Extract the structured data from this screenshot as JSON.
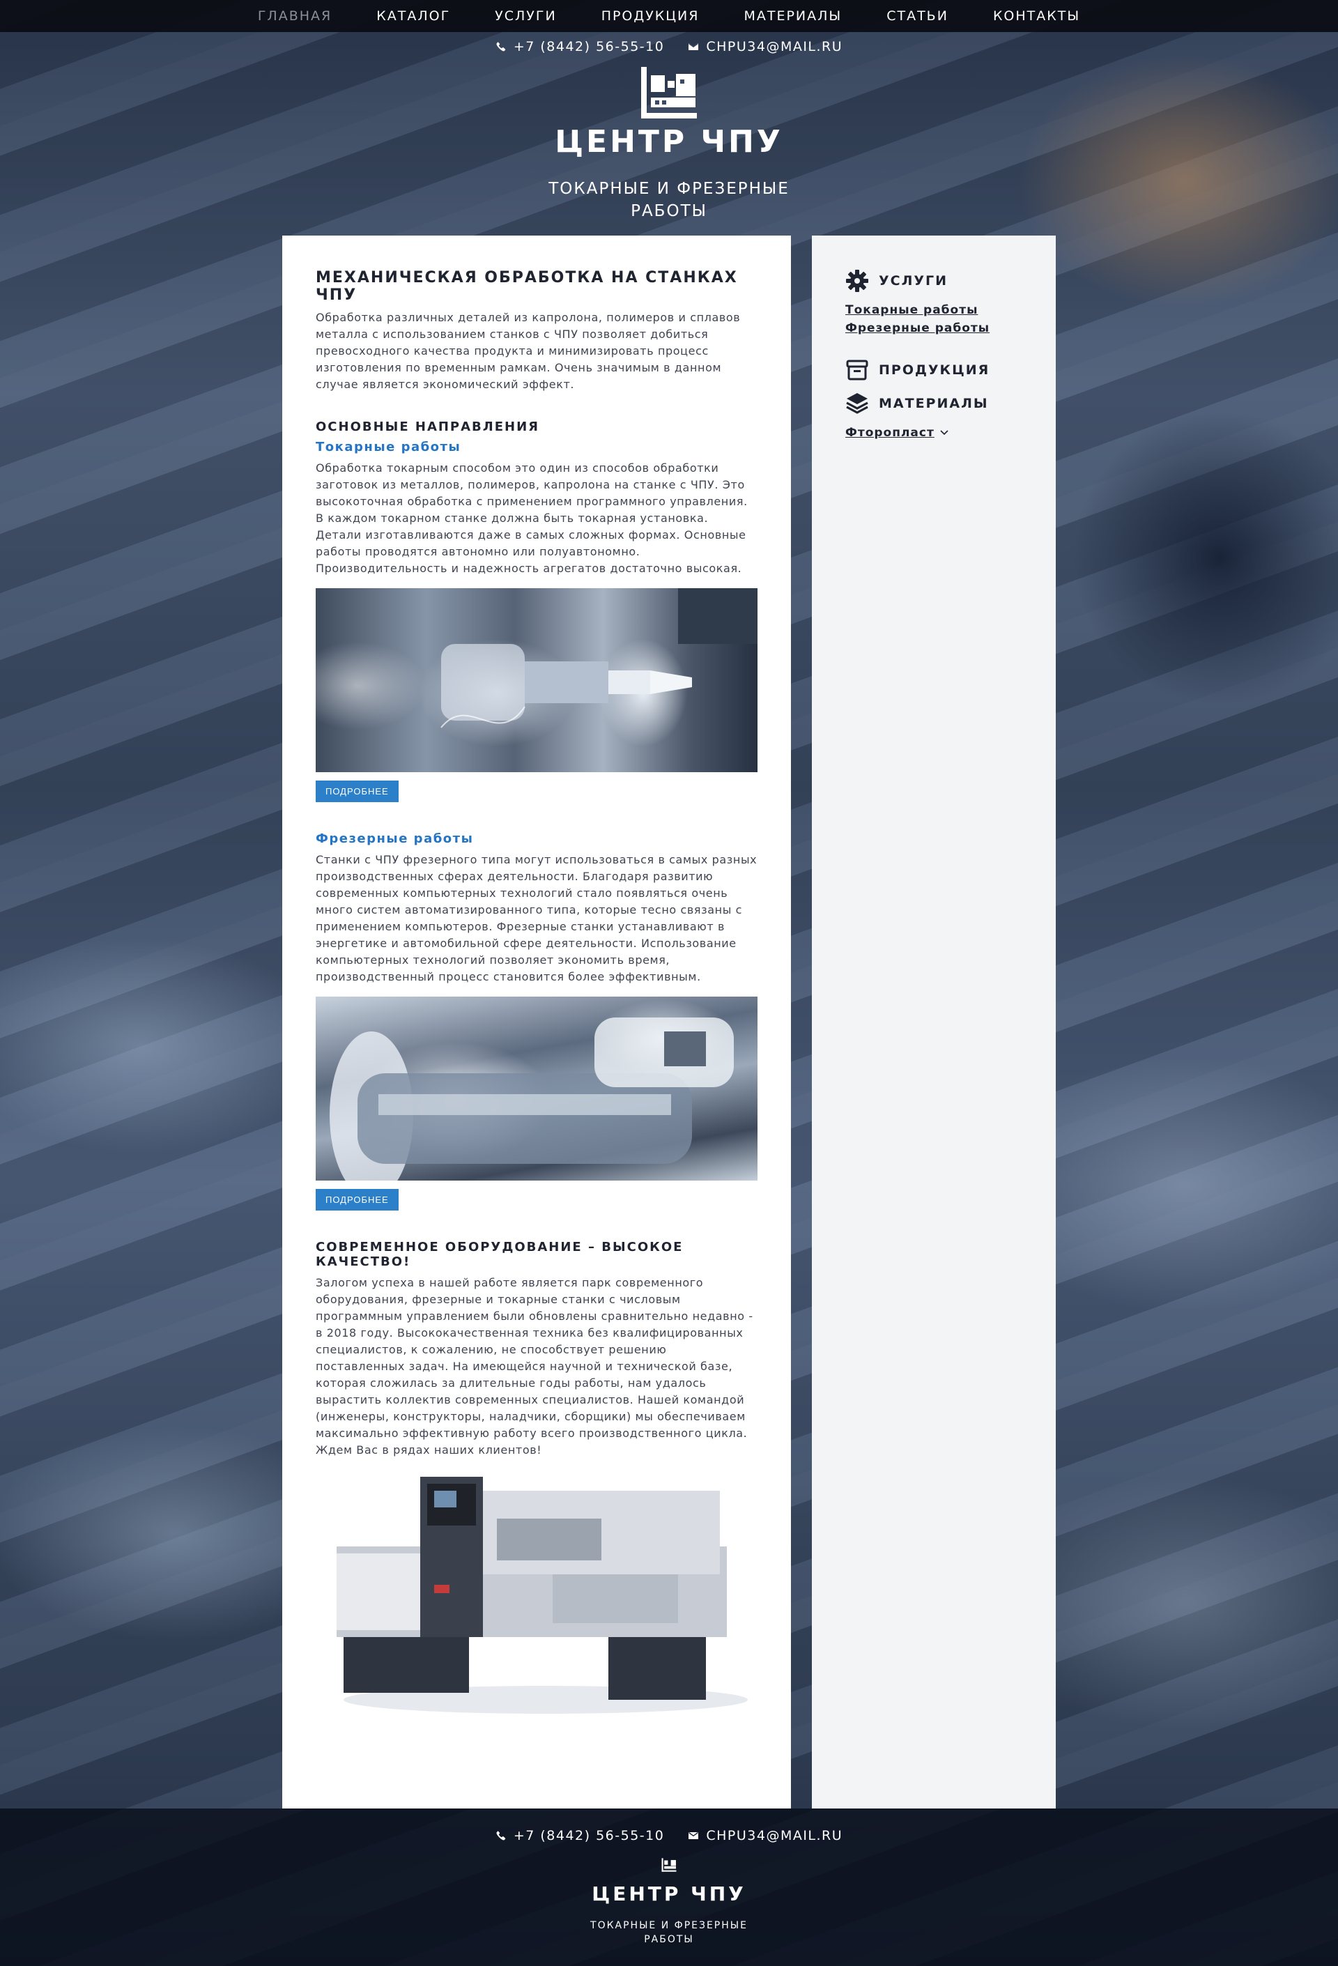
{
  "nav": {
    "items": [
      {
        "label": "ГЛАВНАЯ",
        "active": true
      },
      {
        "label": "КАТАЛОГ"
      },
      {
        "label": "УСЛУГИ"
      },
      {
        "label": "ПРОДУКЦИЯ"
      },
      {
        "label": "МАТЕРИАЛЫ"
      },
      {
        "label": "СТАТЬИ"
      },
      {
        "label": "КОНТАКТЫ"
      }
    ]
  },
  "header": {
    "phone": "+7 (8442) 56-55-10",
    "email": "CHPU34@MAIL.RU",
    "title": "ЦЕНТР ЧПУ",
    "subtitle_line1": "ТОКАРНЫЕ И ФРЕЗЕРНЫЕ",
    "subtitle_line2": "РАБОТЫ"
  },
  "main": {
    "h1": "МЕХАНИЧЕСКАЯ ОБРАБОТКА НА СТАНКАХ ЧПУ",
    "intro": "Обработка различных деталей из капролона, полимеров и сплавов металла с использованием станков с ЧПУ позволяет добиться превосходного качества продукта и минимизировать процесс изготовления по временным рамкам. Очень значимым в данном случае является экономический эффект.",
    "directions_title": "ОСНОВНЫЕ НАПРАВЛЕНИЯ",
    "turning_title": "Токарные работы",
    "turning_text": "Обработка токарным способом это один из способов обработки заготовок из металлов, полимеров, капролона на станке с ЧПУ. Это высокоточная обработка с применением программного управления. В каждом токарном станке должна быть токарная установка. Детали изготавливаются даже в самых сложных формах. Основные работы проводятся автономно или полуавтономно. Производительность и надежность агрегатов достаточно высокая.",
    "more_label": "ПОДРОБНЕЕ",
    "milling_title": "Фрезерные работы",
    "milling_text": "Станки с ЧПУ фрезерного типа могут использоваться в самых разных производственных сферах деятельности. Благодаря развитию современных компьютерных технологий стало появляться очень много систем автоматизированного типа, которые тесно связаны с применением компьютеров. Фрезерные станки устанавливают в энергетике и автомобильной сфере деятельности. Использование компьютерных технологий позволяет экономить время, производственный процесс становится более эффективным.",
    "equipment_title": "СОВРЕМЕННОЕ ОБОРУДОВАНИЕ – ВЫСОКОЕ КАЧЕСТВО!",
    "equipment_text": "Залогом успеха в нашей работе является парк современного оборудования, фрезерные и токарные станки с числовым программным управлением были обновлены сравнительно недавно - в 2018 году. Высококачественная техника без квалифицированных специалистов, к сожалению, не способствует решению поставленных задач. На имеющейся научной и технической базе, которая сложилась за длительные годы работы, нам удалось вырастить коллектив современных специалистов. Нашей командой (инженеры, конструкторы, наладчики, сборщики) мы обеспечиваем максимально эффективную работу всего производственного цикла.",
    "equipment_closing": "Ждем Вас в рядах наших клиентов!"
  },
  "sidebar": {
    "services_title": "УСЛУГИ",
    "services_items": [
      "Токарные работы",
      "Фрезерные работы"
    ],
    "products_title": "ПРОДУКЦИЯ",
    "materials_title": "МАТЕРИАЛЫ",
    "materials_item": "Фторопласт"
  },
  "footer": {
    "phone": "+7 (8442) 56-55-10",
    "email": "CHPU34@MAIL.RU",
    "title": "ЦЕНТР ЧПУ",
    "subtitle_line1": "ТОКАРНЫЕ И ФРЕЗЕРНЫЕ",
    "subtitle_line2": "РАБОТЫ"
  },
  "icons": [
    "phone-icon",
    "envelope-icon",
    "cnc-logo-icon",
    "gear-icon",
    "box-icon",
    "layers-icon",
    "chevron-down-icon"
  ]
}
